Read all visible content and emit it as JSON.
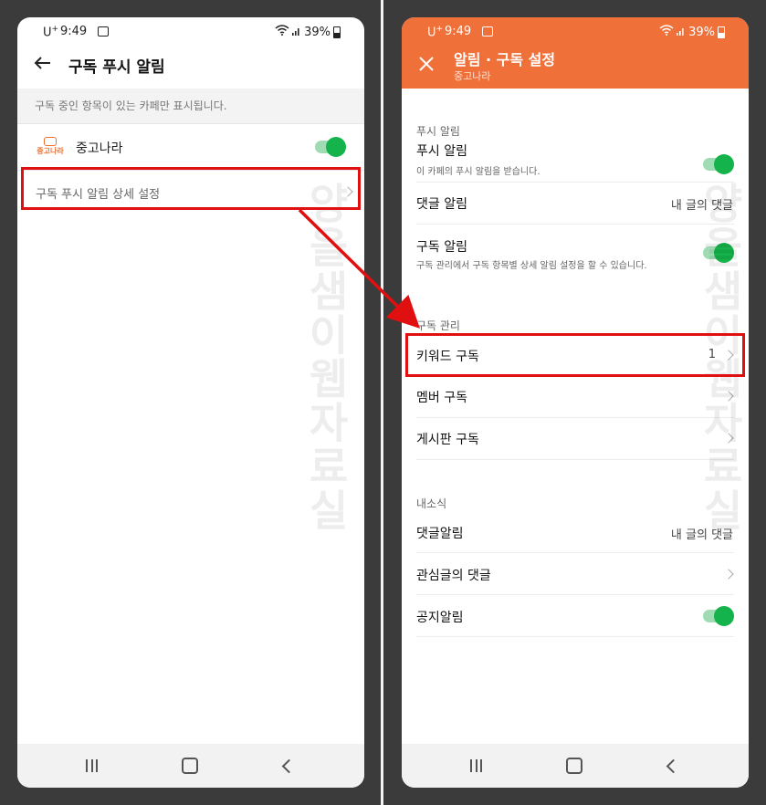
{
  "status_bar": {
    "carrier": "U",
    "carrier_sup": "+",
    "time": "9:49",
    "battery": "39%"
  },
  "left_screen": {
    "title": "구독 푸시 알림",
    "info_text": "구독 중인 항목이 있는 카페만 표시됩니다.",
    "cafe": {
      "logo_text": "중고나라",
      "name": "중고나라",
      "toggle_on": true
    },
    "detail_settings_label": "구독 푸시 알림 상세 설정"
  },
  "right_screen": {
    "title": "알림 · 구독 설정",
    "subtitle": "중고나라",
    "push_section": {
      "header": "푸시 알림",
      "push_alarm": {
        "label": "푸시 알림",
        "sub": "이 카페의 푸시 알림을 받습니다.",
        "toggle_on": true
      },
      "comment_alarm": {
        "label": "댓글 알림",
        "value": "내 글의 댓글"
      },
      "subscribe_alarm": {
        "label": "구독 알림",
        "sub": "구독 관리에서 구독 항목별 상세 알림 설정을 할 수 있습니다.",
        "toggle_on": true
      }
    },
    "manage_section": {
      "header": "구독 관리",
      "keyword": {
        "label": "키워드 구독",
        "count": "1"
      },
      "member": {
        "label": "멤버 구독"
      },
      "board": {
        "label": "게시판 구독"
      }
    },
    "news_section": {
      "header": "내소식",
      "comment": {
        "label": "댓글알림",
        "value": "내 글의 댓글"
      },
      "interest": {
        "label": "관심글의 댓글"
      },
      "notice": {
        "label": "공지알림",
        "toggle_on": true
      }
    }
  },
  "watermark": "양을샘이웹자료실",
  "colors": {
    "accent": "#f0703a",
    "toggle": "#15b34b",
    "highlight": "#e01010"
  }
}
